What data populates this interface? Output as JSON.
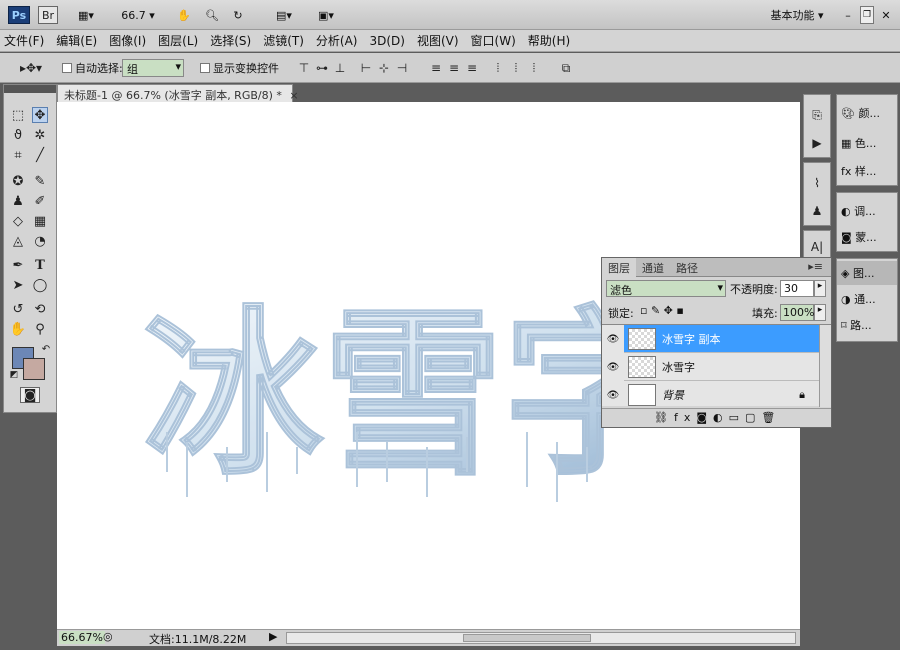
{
  "appbar": {
    "logo": "Ps",
    "bridge": "Br",
    "zoom": "66.7",
    "workspace": "基本功能"
  },
  "menus": [
    "文件(F)",
    "编辑(E)",
    "图像(I)",
    "图层(L)",
    "选择(S)",
    "滤镜(T)",
    "分析(A)",
    "3D(D)",
    "视图(V)",
    "窗口(W)",
    "帮助(H)"
  ],
  "options": {
    "auto_select_label": "自动选择:",
    "auto_select_value": "组",
    "show_transform": "显示变换控件"
  },
  "document": {
    "tab_title": "未标题-1 @ 66.7% (冰雪字 副本, RGB/8) *",
    "canvas_text": "冰雪字"
  },
  "status": {
    "zoom": "66.67%",
    "doc_info": "文档:11.1M/8.22M"
  },
  "right_panels": {
    "items": [
      "颜...",
      "色...",
      "样...",
      "调...",
      "蒙...",
      "图...",
      "通...",
      "路..."
    ]
  },
  "layers_panel": {
    "tabs": [
      "图层",
      "通道",
      "路径"
    ],
    "blend_mode": "滤色",
    "opacity_label": "不透明度:",
    "opacity_value": "30",
    "lock_label": "锁定:",
    "fill_label": "填充:",
    "fill_value": "100%",
    "layers": [
      {
        "name": "冰雪字 副本",
        "selected": true
      },
      {
        "name": "冰雪字",
        "selected": false
      },
      {
        "name": "背景",
        "selected": false
      }
    ]
  },
  "colors": {
    "foreground": "#6c87b6",
    "background": "#c5a9a1",
    "ice_light": "#dbe8f3",
    "ice_dark": "#6a91b9",
    "selection": "#3c9cff"
  }
}
